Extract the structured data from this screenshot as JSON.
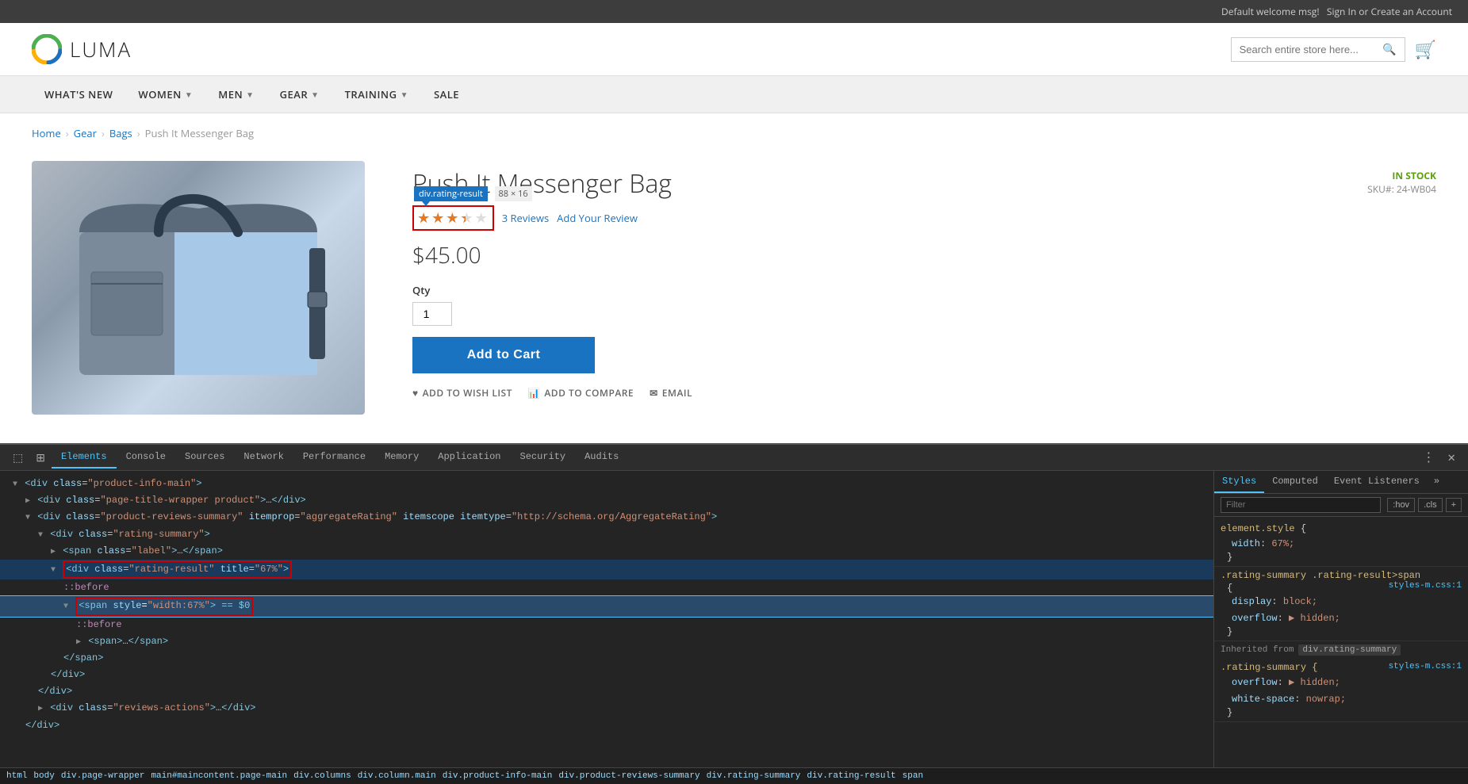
{
  "topbar": {
    "welcome": "Default welcome msg!",
    "signin": "Sign In",
    "or": "or",
    "create": "Create an Account"
  },
  "header": {
    "logo_text": "LUMA",
    "search_placeholder": "Search entire store here...",
    "cart_icon": "🛒"
  },
  "nav": {
    "items": [
      {
        "label": "What's New",
        "has_chevron": false
      },
      {
        "label": "Women",
        "has_chevron": true
      },
      {
        "label": "Men",
        "has_chevron": true
      },
      {
        "label": "Gear",
        "has_chevron": true
      },
      {
        "label": "Training",
        "has_chevron": true
      },
      {
        "label": "Sale",
        "has_chevron": false
      }
    ]
  },
  "breadcrumb": {
    "items": [
      "Home",
      "Gear",
      "Bags"
    ],
    "current": "Push It Messenger Bag"
  },
  "product": {
    "title": "Push It Messenger Bag",
    "rating_tooltip": "div.rating-result",
    "rating_size": "88 × 16",
    "rating_pct": 67,
    "reviews_count": "3 Reviews",
    "add_review": "Add Your Review",
    "price": "$45.00",
    "stock": "IN STOCK",
    "sku_label": "SKU#:",
    "sku": "24-WB04",
    "qty_label": "Qty",
    "qty_value": "1",
    "add_to_cart": "Add to Cart",
    "wish_list": "ADD TO WISH LIST",
    "compare": "ADD TO COMPARE",
    "email": "EMAIL"
  },
  "devtools": {
    "tabs": [
      "Elements",
      "Console",
      "Sources",
      "Network",
      "Performance",
      "Memory",
      "Application",
      "Security",
      "Audits"
    ],
    "active_tab": "Elements",
    "dom_lines": [
      {
        "indent": 0,
        "html": "<div class=\"product-info-main\">"
      },
      {
        "indent": 1,
        "html": "<div class=\"page-title-wrapper product\">…</div>"
      },
      {
        "indent": 1,
        "html": "<div class=\"product-reviews-summary\" itemprop=\"aggregateRating\" itemscope itemtype=\"http://schema.org/AggregateRating\">"
      },
      {
        "indent": 2,
        "html": "<div class=\"rating-summary\">"
      },
      {
        "indent": 3,
        "html": "<span class=\"label\">…</span>"
      },
      {
        "indent": 3,
        "html": "<div class=\"rating-result\" title=\"67%\">",
        "highlight": true
      },
      {
        "indent": 4,
        "html": "::before",
        "pseudo": true
      },
      {
        "indent": 4,
        "html": "<span style=\"width:67%\"> == $0",
        "selected": true
      },
      {
        "indent": 5,
        "html": "::before",
        "pseudo": true
      },
      {
        "indent": 5,
        "html": "<span>…</span>"
      },
      {
        "indent": 4,
        "html": "</span>"
      },
      {
        "indent": 3,
        "html": "</div>"
      },
      {
        "indent": 2,
        "html": "</div>"
      },
      {
        "indent": 2,
        "html": "<div class=\"reviews-actions\">…</div>"
      },
      {
        "indent": 1,
        "html": "</div>"
      }
    ],
    "breadcrumb_items": [
      "html",
      "body",
      "div.page-wrapper",
      "main#maincontent.page-main",
      "div.columns",
      "div.column.main",
      "div.product-info-main",
      "div.product-reviews-summary",
      "div.rating-summary",
      "div.rating-result",
      "span"
    ],
    "styles": {
      "tabs": [
        "Styles",
        "Computed",
        "Event Listeners"
      ],
      "active": "Styles",
      "filter_placeholder": "Filter",
      "filter_btns": [
        ":hov",
        ".cls",
        "+"
      ],
      "rules": [
        {
          "selector": "element.style {",
          "source": "",
          "props": [
            {
              "name": "width",
              "value": "67%;"
            }
          ]
        },
        {
          "selector": ".rating-summary .rating-result>span",
          "source": "styles-m.css:1",
          "props": [
            {
              "name": "display",
              "value": "block;"
            },
            {
              "name": "overflow",
              "value": "▶ hidden;"
            }
          ]
        },
        {
          "inherited_from": "div.rating-summary",
          "selector": ".rating-summary {",
          "source": "styles-m.css:1",
          "props": [
            {
              "name": "overflow",
              "value": "▶ hidden;"
            },
            {
              "name": "white-space",
              "value": "nowrap;"
            }
          ]
        }
      ]
    }
  }
}
